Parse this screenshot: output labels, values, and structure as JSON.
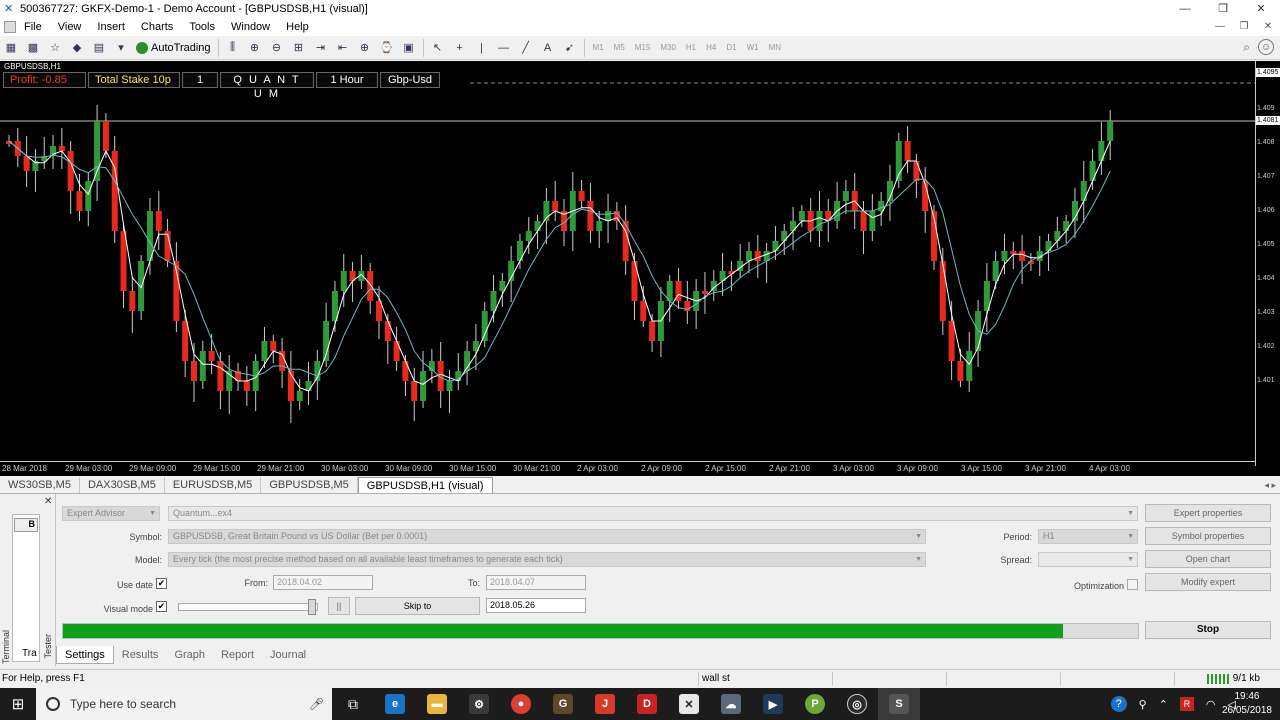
{
  "window": {
    "title": "500367727: GKFX-Demo-1 - Demo Account - [GBPUSDSB,H1 (visual)]",
    "minimize": "—",
    "restore": "❐",
    "close": "✕"
  },
  "menu": [
    "File",
    "View",
    "Insert",
    "Charts",
    "Tools",
    "Window",
    "Help"
  ],
  "toolbar": {
    "autotrading_label": "AutoTrading",
    "timeframes": [
      "M1",
      "M5",
      "M15",
      "M30",
      "H1",
      "H4",
      "D1",
      "W1",
      "MN"
    ]
  },
  "chart": {
    "symbol_label": "GBPUSDSB,H1",
    "panel": {
      "profit": "Profit: -0.85",
      "stake": "Total Stake 10p",
      "qty": "1",
      "name": "Q U A N T U M",
      "timeframe": "1 Hour",
      "pair": "Gbp-Usd"
    },
    "price_labels": [
      "1.409",
      "1.408",
      "1.407",
      "1.406",
      "1.405",
      "1.404",
      "1.403",
      "1.402",
      "1.401"
    ],
    "price_tags": [
      "1.4095",
      "1.4081"
    ],
    "time_labels": [
      "28 Mar 2018",
      "29 Mar 03:00",
      "29 Mar 09:00",
      "29 Mar 15:00",
      "29 Mar 21:00",
      "30 Mar 03:00",
      "30 Mar 09:00",
      "30 Mar 15:00",
      "30 Mar 21:00",
      "2 Apr 03:00",
      "2 Apr 09:00",
      "2 Apr 15:00",
      "2 Apr 21:00",
      "3 Apr 03:00",
      "3 Apr 09:00",
      "3 Apr 15:00",
      "3 Apr 21:00",
      "4 Apr 03:00"
    ],
    "bull_color": "#2e9a3a",
    "bear_color": "#e8291c"
  },
  "chart_tabs": [
    "WS30SB,M5",
    "DAX30SB,M5",
    "EURUSDSB,M5",
    "GBPUSDSB,M5",
    "GBPUSDSB,H1 (visual)"
  ],
  "tester": {
    "type_select": "Expert Advisor",
    "ea_select": "Quantum...ex4",
    "symbol_label": "Symbol:",
    "symbol_value": "GBPUSDSB, Great Britain Pound vs US Dollar (Bet per 0.0001)",
    "model_label": "Model:",
    "model_value": "Every tick (the most precise method based on all available least timeframes to generate each tick)",
    "use_date_label": "Use date",
    "from_label": "From:",
    "from_value": "2018.04.02",
    "to_label": "To:",
    "to_value": "2018.04.07",
    "visual_mode_label": "Visual mode",
    "skip_to_label": "Skip to",
    "skip_date": "2018.05.26",
    "period_label": "Period:",
    "period_value": "H1",
    "spread_label": "Spread:",
    "optimization_label": "Optimization",
    "btn_expert_properties": "Expert properties",
    "btn_symbol_properties": "Symbol properties",
    "btn_open_chart": "Open chart",
    "btn_modify_expert": "Modify expert",
    "btn_stop": "Stop",
    "progress": 0.93,
    "tabs": [
      "Settings",
      "Results",
      "Graph",
      "Report",
      "Journal"
    ],
    "side_terminal": "Terminal",
    "side_tester": "Tester",
    "side_tra": "Tra",
    "side_box": "B",
    "check_mark": "✔",
    "pause": "||"
  },
  "status": {
    "help": "For Help, press F1",
    "profile": "wall st",
    "conn": "9/1 kb"
  },
  "taskbar": {
    "search_placeholder": "Type here to search",
    "time": "19:46",
    "date": "26/05/2018"
  }
}
